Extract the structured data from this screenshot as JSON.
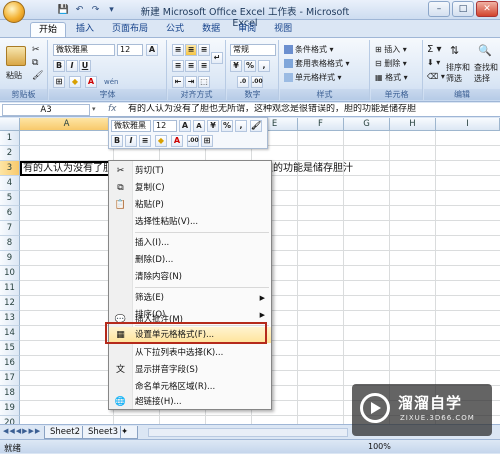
{
  "window": {
    "title": "新建 Microsoft Office Excel 工作表 - Microsoft Excel",
    "min": "–",
    "max": "□",
    "close": "✕"
  },
  "qat": {
    "save": "💾",
    "undo": "↶",
    "redo": "↷",
    "more": "▾"
  },
  "tabs": [
    "开始",
    "插入",
    "页面布局",
    "公式",
    "数据",
    "审阅",
    "视图"
  ],
  "ribbon": {
    "clipboard": {
      "label": "剪贴板",
      "paste": "粘贴"
    },
    "font": {
      "label": "字体",
      "name": "微软雅黑",
      "size": "12",
      "bold": "B",
      "italic": "I",
      "underline": "U",
      "font_color_glyph": "A",
      "wen": "wén"
    },
    "alignment": {
      "label": "对齐方式"
    },
    "number": {
      "label": "数字",
      "format": "常规",
      "percent": "%",
      "comma": ","
    },
    "styles": {
      "label": "样式",
      "cond": "条件格式",
      "table": "套用表格格式",
      "cell": "单元格样式"
    },
    "cells": {
      "label": "单元格",
      "insert": "插入",
      "delete": "删除",
      "format": "格式"
    },
    "editing": {
      "label": "编辑",
      "sort": "排序和",
      "sort2": "筛选",
      "find": "查找和",
      "find2": "选择"
    }
  },
  "formula_bar": {
    "name_box": "A3",
    "fx": "fx",
    "content": "有的人认为没有了胆也无所谓，这种观念是很错误的，胆的功能是储存胆"
  },
  "grid": {
    "columns": [
      "A",
      "B",
      "C",
      "D",
      "E",
      "F",
      "G",
      "H",
      "I"
    ],
    "rows": [
      "1",
      "2",
      "3",
      "4",
      "5",
      "6",
      "7",
      "8",
      "9",
      "10",
      "11",
      "12",
      "13",
      "14",
      "15",
      "16",
      "17",
      "18",
      "19",
      "20"
    ],
    "cell_a3": "有的人认为没有了胆也无所谓，这种观念是很错误的，胆的功能是储存胆汁"
  },
  "mini_toolbar": {
    "font": "微软雅黑",
    "size": "12",
    "bold": "B",
    "italic": "I",
    "align": "≡",
    "fill": "◆",
    "color": "A",
    "percent": "%",
    "comma": ","
  },
  "context_menu": {
    "items": [
      {
        "label": "剪切(T)",
        "icon": "✂"
      },
      {
        "label": "复制(C)",
        "icon": "⧉"
      },
      {
        "label": "粘贴(P)",
        "icon": "📋"
      },
      {
        "label": "选择性粘贴(V)...",
        "icon": ""
      },
      {
        "label": "插入(I)...",
        "icon": ""
      },
      {
        "label": "删除(D)...",
        "icon": ""
      },
      {
        "label": "清除内容(N)",
        "icon": ""
      },
      {
        "label": "筛选(E)",
        "icon": "",
        "arrow": "▶"
      },
      {
        "label": "排序(O)",
        "icon": "",
        "arrow": "▶"
      },
      {
        "label": "插入批注(M)",
        "icon": "💬"
      },
      {
        "label": "设置单元格格式(F)...",
        "icon": "▦"
      },
      {
        "label": "从下拉列表中选择(K)...",
        "icon": ""
      },
      {
        "label": "显示拼音字段(S)",
        "icon": "文"
      },
      {
        "label": "命名单元格区域(R)...",
        "icon": ""
      },
      {
        "label": "超链接(H)...",
        "icon": "🌐"
      }
    ]
  },
  "sheets": {
    "tab1": "Sheet2",
    "tab2": "Sheet3"
  },
  "status": {
    "ready": "就绪",
    "zoom": "100%"
  },
  "watermark": {
    "cn": "溜溜自学",
    "url": "ZIXUE.3D66.COM"
  },
  "colors": {
    "accent": "#15428b",
    "highlight_box": "#b52a1b",
    "ribbon": "#dbe7f5"
  }
}
